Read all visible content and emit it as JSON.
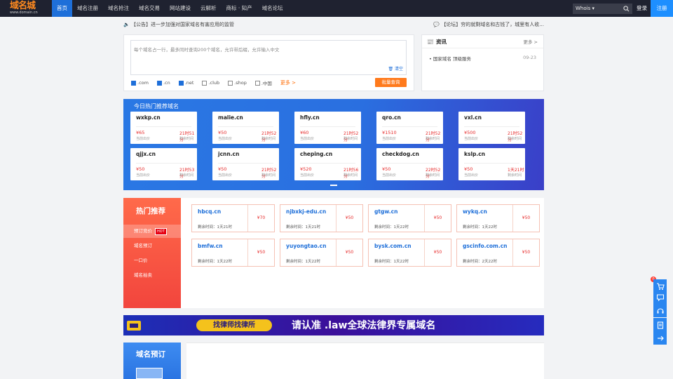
{
  "brand": {
    "logo_text": "域名城",
    "logo_sub": "www.domain.cn"
  },
  "nav": [
    "首页",
    "域名注册",
    "域名抢注",
    "域名交易",
    "网站建设",
    "云解析",
    "商标 · 知产",
    "域名论坛"
  ],
  "header": {
    "whois_label": "Whois",
    "login": "登录",
    "register": "注册"
  },
  "notice": {
    "left": "【公告】进一步加强对国家域名有害应用的监管",
    "right": "【论坛】穷的就剩域名和古钱了，城里有人收..."
  },
  "search": {
    "placeholder": "每个域名占一行，最多同时查询200个域名，允许带后缀，允许输入中文",
    "clear": "清空",
    "extensions": [
      {
        "label": ".com",
        "checked": true
      },
      {
        "label": ".cn",
        "checked": true
      },
      {
        "label": ".net",
        "checked": true
      },
      {
        "label": ".club",
        "checked": false
      },
      {
        "label": ".shop",
        "checked": false
      },
      {
        "label": ".中国",
        "checked": false
      }
    ],
    "more": "更多 >",
    "bulk": "批量查询"
  },
  "news": {
    "title": "资讯",
    "more": "更多 >",
    "items": [
      {
        "text": "国家域名 顶级服务",
        "date": "09-23"
      }
    ]
  },
  "hot_today": {
    "title": "今日热门推荐域名",
    "price_label": "当前出价",
    "time_label": "剩余时间",
    "cards": [
      {
        "name": "wxkp.cn",
        "price": "¥65",
        "time": "21时51分"
      },
      {
        "name": "malie.cn",
        "price": "¥50",
        "time": "21时52分"
      },
      {
        "name": "hfly.cn",
        "price": "¥60",
        "time": "21时52分"
      },
      {
        "name": "qro.cn",
        "price": "¥1510",
        "time": "21时52分"
      },
      {
        "name": "vxl.cn",
        "price": "¥500",
        "time": "21时52分"
      },
      {
        "name": "qjjx.cn",
        "price": "¥50",
        "time": "21时53分"
      },
      {
        "name": "jcnn.cn",
        "price": "¥50",
        "time": "21时52分"
      },
      {
        "name": "cheping.cn",
        "price": "¥520",
        "time": "21时56分"
      },
      {
        "name": "checkdog.cn",
        "price": "¥50",
        "time": "22时52分"
      },
      {
        "name": "kslp.cn",
        "price": "¥50",
        "time": "1天21时"
      }
    ]
  },
  "recommend": {
    "title": "热门推荐",
    "hot_badge": "HOT",
    "menu": [
      "预订竞价",
      "域名预订",
      "一口价",
      "域名拍卖"
    ],
    "cards": [
      {
        "name": "hbcq.cn",
        "time": "剩余时间：1天21时",
        "price": "¥70"
      },
      {
        "name": "njbxkj-edu.cn",
        "time": "剩余时间：1天21时",
        "price": "¥50"
      },
      {
        "name": "gtgw.cn",
        "time": "剩余时间：1天22时",
        "price": "¥50"
      },
      {
        "name": "wykq.cn",
        "time": "剩余时间：1天22时",
        "price": "¥50"
      },
      {
        "name": "bmfw.cn",
        "time": "剩余时间：1天22时",
        "price": "¥50"
      },
      {
        "name": "yuyongtao.cn",
        "time": "剩余时间：1天22时",
        "price": "¥50"
      },
      {
        "name": "bysk.com.cn",
        "time": "剩余时间：1天22时",
        "price": "¥50"
      },
      {
        "name": "gscinfo.com.cn",
        "time": "剩余时间：2天22时",
        "price": "¥50"
      }
    ]
  },
  "law_banner": {
    "button": "找律师找律所",
    "text": "请认准  .law全球法律界专属域名"
  },
  "presell": {
    "title": "域名预订"
  },
  "sidebar": {
    "cart_count": "0"
  },
  "colors": {
    "nav_active": "#1e6fd9",
    "accent_orange": "#ff7a1c",
    "price_red": "#e62a2a",
    "banner_blue": "#2a78e4",
    "recommend_red": "#f2453d"
  }
}
